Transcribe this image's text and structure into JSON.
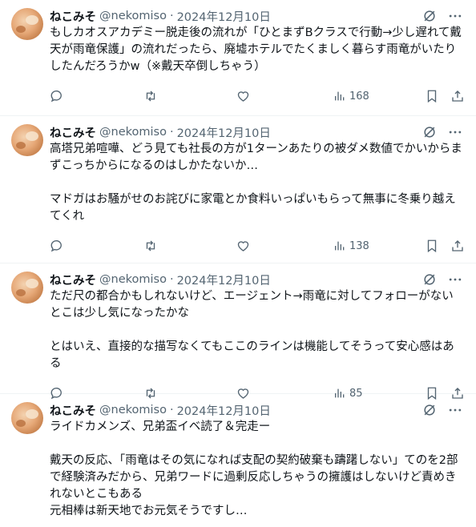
{
  "tweets": [
    {
      "name": "ねこみそ",
      "handle": "@nekomiso",
      "sep": "·",
      "date": "2024年12月10日",
      "text": "もしカオスアカデミー脱走後の流れが「ひとまずBクラスで行動→少し遅れて戴天が雨竜保護」の流れだったら、廃墟ホテルでたくましく暮らす雨竜がいたりしたんだろうかw（※戴天卒倒しちゃう）",
      "views": "168"
    },
    {
      "name": "ねこみそ",
      "handle": "@nekomiso",
      "sep": "·",
      "date": "2024年12月10日",
      "text": "高塔兄弟喧嘩、どう見ても社長の方が1ターンあたりの被ダメ数値でかいからまずこっちからになるのはしかたないか…\n\nマドガはお騒がせのお詫びに家電とか食料いっぱいもらって無事に冬乗り越えてくれ",
      "views": "138"
    },
    {
      "name": "ねこみそ",
      "handle": "@nekomiso",
      "sep": "·",
      "date": "2024年12月10日",
      "text": "ただ尺の都合かもしれないけど、エージェント→雨竜に対してフォローがないとこは少し気になったかな\n\nとはいえ、直接的な描写なくてもここのラインは機能してそうって安心感はある",
      "views": "85"
    },
    {
      "name": "ねこみそ",
      "handle": "@nekomiso",
      "sep": "·",
      "date": "2024年12月10日",
      "text": "ライドカメンズ、兄弟盃イベ読了＆完走ー\n\n戴天の反応、「雨竜はその気になれば支配の契約破棄も躊躇しない」てのを2部で経験済みだから、兄弟ワードに過剰反応しちゃうの擁護はしないけど責めきれないとこもある\n元相棒は新天地でお元気そうですし…",
      "views": ""
    }
  ],
  "icons": {
    "grok": "grok-icon",
    "more": "more-icon",
    "reply": "reply-icon",
    "retweet": "retweet-icon",
    "like": "like-icon",
    "views": "views-icon",
    "bookmark": "bookmark-icon",
    "share": "share-icon"
  },
  "colors": {
    "text": "#0f1419",
    "secondary": "#536471",
    "divider": "#eff3f4"
  }
}
